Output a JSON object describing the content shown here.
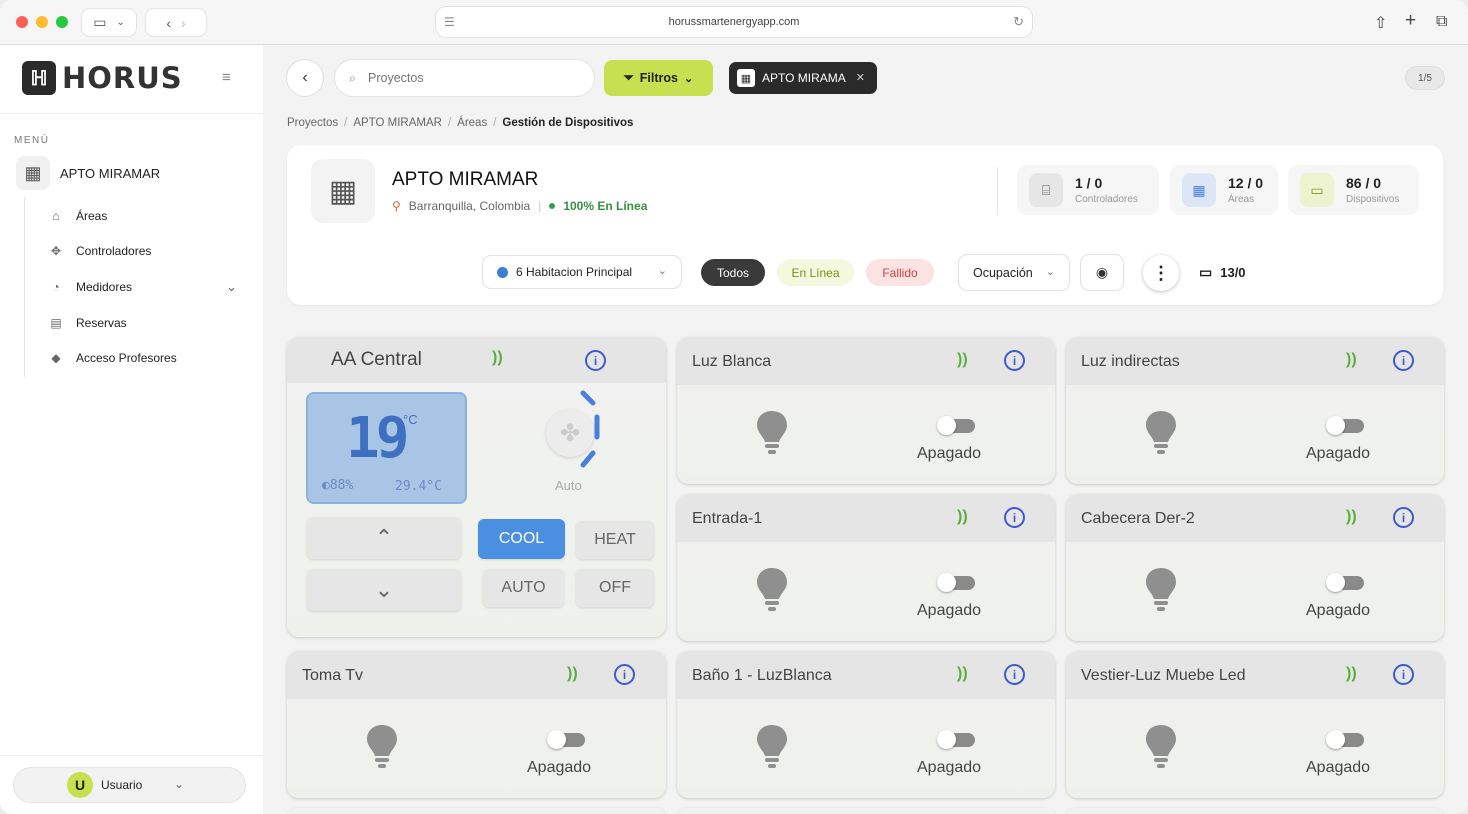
{
  "browser": {
    "url": "horussmartenergyapp.com",
    "tab_count": ""
  },
  "sidebar": {
    "brand": "HORUS",
    "menu_label": "MENÚ",
    "project": "APTO MIRAMAR",
    "items": [
      {
        "label": "Áreas",
        "icon": "areas-icon"
      },
      {
        "label": "Controladores",
        "icon": "controllers-icon"
      },
      {
        "label": "Medidores",
        "icon": "meters-icon"
      },
      {
        "label": "Reservas",
        "icon": "calendar-icon"
      },
      {
        "label": "Acceso Profesores",
        "icon": "graduation-icon"
      }
    ],
    "user": {
      "initial": "U",
      "name": "Usuario"
    }
  },
  "toolbar": {
    "search_placeholder": "Proyectos",
    "filters_label": "Filtros",
    "chip_label": "APTO MIRAMA",
    "pager": "1/5"
  },
  "breadcrumb": [
    "Proyectos",
    "APTO MIRAMAR",
    "Áreas",
    "Gestión de Dispositivos"
  ],
  "project": {
    "name": "APTO MIRAMAR",
    "location": "Barranquilla, Colombia",
    "status": "100% En Línea",
    "stats": [
      {
        "value": "1 / 0",
        "label": "Controladores"
      },
      {
        "value": "12 / 0",
        "label": "Áreas"
      },
      {
        "value": "86 / 0",
        "label": "Dispositivos"
      }
    ],
    "area_select": "6 Habitacion Principal",
    "filters": [
      "Todos",
      "En Línea",
      "Fallido"
    ],
    "occupancy": "Ocupación",
    "device_count": "13/0"
  },
  "colors": {
    "accent": "#c7e04f",
    "ac_mode": "#4a8fe0",
    "signal": "#59ae3c",
    "info": "#3f5bc9"
  },
  "ac": {
    "title": "AA Central",
    "setpoint": "19",
    "unit": "°C",
    "humidity": "88%",
    "ambient": "29.4°C",
    "fan_mode": "Auto",
    "modes": [
      "COOL",
      "HEAT",
      "AUTO",
      "OFF"
    ],
    "active_mode": "COOL"
  },
  "devices": [
    {
      "name": "Luz Blanca",
      "state": "Apagado"
    },
    {
      "name": "Luz indirectas",
      "state": "Apagado"
    },
    {
      "name": "Entrada-1",
      "state": "Apagado"
    },
    {
      "name": "Cabecera Der-2",
      "state": "Apagado"
    },
    {
      "name": "Toma Tv",
      "state": "Apagado"
    },
    {
      "name": "Baño 1 - LuzBlanca",
      "state": "Apagado"
    },
    {
      "name": "Vestier-Luz Muebe Led",
      "state": "Apagado"
    }
  ]
}
